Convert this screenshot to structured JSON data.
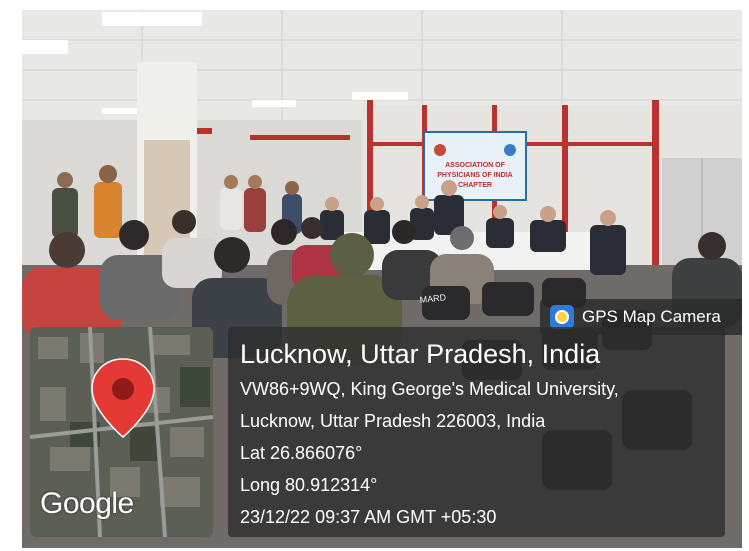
{
  "banner": {
    "line1": "ASSOCIATION OF",
    "line2": "PHYSICIANS OF INDIA",
    "line3": "CHAPTER"
  },
  "gps_badge": {
    "label": "GPS Map Camera",
    "icon": "gps-map-camera-app-icon"
  },
  "map": {
    "provider": "Google",
    "pin_icon": "map-pin-icon",
    "pin_color": "#e53935"
  },
  "location": {
    "title": "Lucknow, Uttar Pradesh, India",
    "address_line1": "VW86+9WQ, King George's Medical University,",
    "address_line2": "Lucknow, Uttar Pradesh 226003, India",
    "latitude": "Lat 26.866076°",
    "longitude": "Long 80.912314°",
    "timestamp": "23/12/22 09:37 AM GMT +05:30"
  }
}
